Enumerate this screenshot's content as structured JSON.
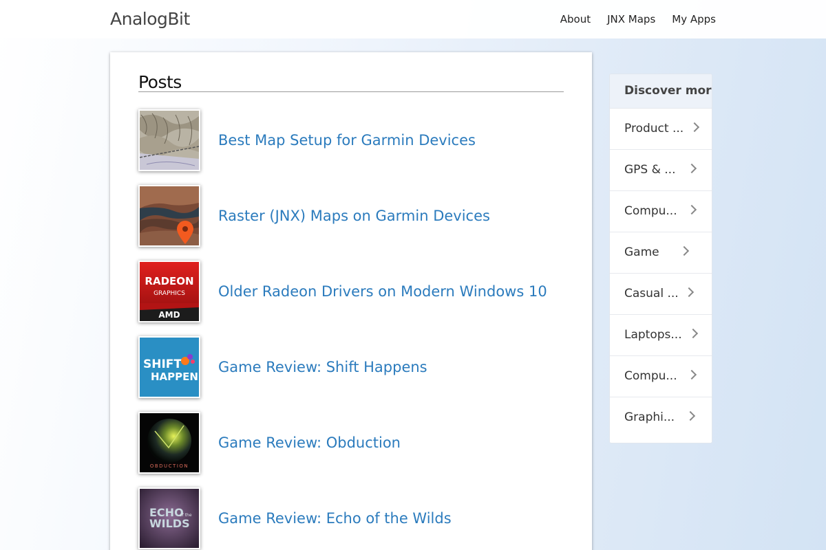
{
  "header": {
    "brand": "AnalogBit",
    "nav": [
      {
        "label": "About"
      },
      {
        "label": "JNX Maps"
      },
      {
        "label": "My Apps"
      }
    ]
  },
  "main": {
    "heading": "Posts",
    "posts": [
      {
        "title": "Best Map Setup for Garmin Devices",
        "thumb_icon": "topo-map-thumbnail"
      },
      {
        "title": "Raster (JNX) Maps on Garmin Devices",
        "thumb_icon": "satellite-map-pin-thumbnail"
      },
      {
        "title": "Older Radeon Drivers on Modern Windows 10",
        "thumb_icon": "radeon-logo-thumbnail",
        "thumb_text": [
          "RADEON",
          "GRAPHICS",
          "AMD"
        ]
      },
      {
        "title": "Game Review: Shift Happens",
        "thumb_icon": "shift-happens-thumbnail",
        "thumb_text": [
          "SHIFT",
          "HAPPENS"
        ]
      },
      {
        "title": "Game Review: Obduction",
        "thumb_icon": "obduction-thumbnail",
        "thumb_text": [
          "OBDUCTION"
        ]
      },
      {
        "title": "Game Review: Echo of the Wilds",
        "thumb_icon": "echo-of-the-wilds-thumbnail",
        "thumb_text": [
          "ECHO",
          "of the",
          "WILDS"
        ]
      }
    ]
  },
  "sidebar": {
    "heading": "Discover more",
    "items": [
      {
        "label": "Product ..."
      },
      {
        "label": "GPS & ..."
      },
      {
        "label": "Compu..."
      },
      {
        "label": "Game"
      },
      {
        "label": "Casual ..."
      },
      {
        "label": "Laptops..."
      },
      {
        "label": "Compu..."
      },
      {
        "label": "Graphi..."
      }
    ]
  },
  "colors": {
    "link": "#2b7bbd",
    "shift_happens_bg": "#2a8fc4",
    "radeon_red": "#d11a1a"
  }
}
